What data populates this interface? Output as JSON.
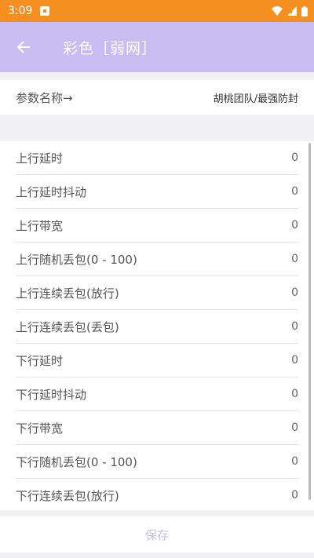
{
  "status_bar": {
    "time": "3:09",
    "icons": [
      "notification-icon",
      "wifi-icon",
      "battery-icon"
    ]
  },
  "app_bar": {
    "back_icon": "arrow-left-icon",
    "title": "彩色［弱网］"
  },
  "param_row": {
    "label": "参数名称→",
    "value": "胡桃团队/最强防封"
  },
  "settings": [
    {
      "label": "上行延时",
      "value": "0"
    },
    {
      "label": "上行延时抖动",
      "value": "0"
    },
    {
      "label": "上行带宽",
      "value": "0"
    },
    {
      "label": "上行随机丢包(0 - 100)",
      "value": "0"
    },
    {
      "label": "上行连续丢包(放行)",
      "value": "0"
    },
    {
      "label": "上行连续丢包(丢包)",
      "value": "0"
    },
    {
      "label": "下行延时",
      "value": "0"
    },
    {
      "label": "下行延时抖动",
      "value": "0"
    },
    {
      "label": "下行带宽",
      "value": "0"
    },
    {
      "label": "下行随机丢包(0 - 100)",
      "value": "0"
    },
    {
      "label": "下行连续丢包(放行)",
      "value": "0"
    }
  ],
  "save_button": {
    "label": "保存"
  },
  "colors": {
    "status_bar": "#f58f1f",
    "app_bar": "#c8bdf3",
    "background": "#f1f1f3"
  }
}
